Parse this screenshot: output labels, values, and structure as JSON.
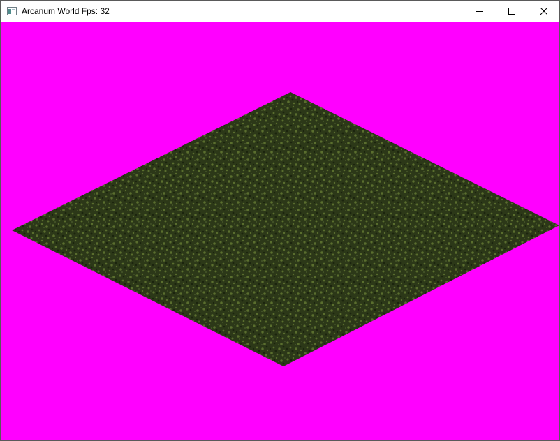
{
  "window": {
    "title": "Arcanum World Fps: 32",
    "icon": "app-window-icon",
    "controls": {
      "minimize_icon": "minimize-icon",
      "maximize_icon": "maximize-icon",
      "close_icon": "close-icon"
    }
  },
  "scene": {
    "background_color": "#ff00ff",
    "tile": {
      "type": "grass",
      "base_color": "#2c3818",
      "highlight_color": "#5a6e2e"
    }
  }
}
